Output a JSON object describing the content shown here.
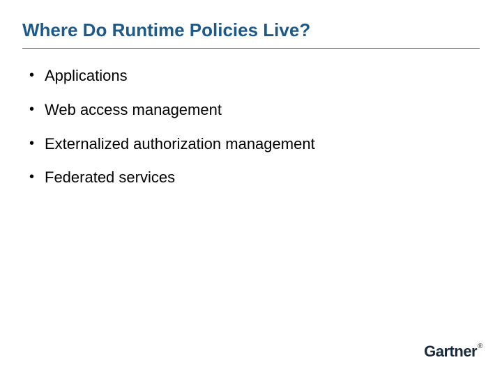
{
  "title": "Where Do Runtime Policies Live?",
  "bullets": [
    "Applications",
    "Web access management",
    "Externalized authorization management",
    "Federated services"
  ],
  "logo": {
    "text": "Gartner",
    "registered": "®"
  }
}
